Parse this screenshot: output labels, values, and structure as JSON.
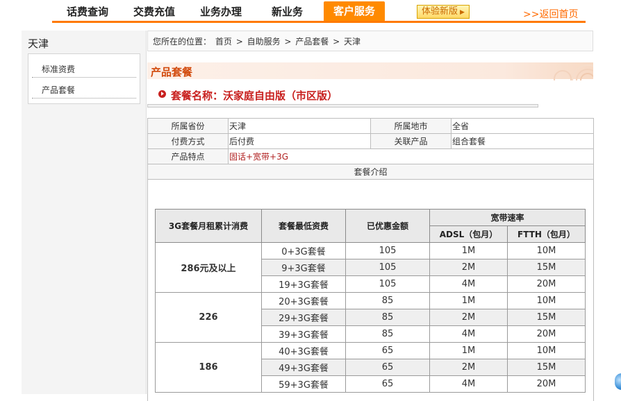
{
  "nav": {
    "items": [
      "话费查询",
      "交费充值",
      "业务办理",
      "新业务",
      "客户服务"
    ],
    "active_index": 4,
    "trial_label": "体验新版",
    "home_label": ">>返回首页"
  },
  "sidebar": {
    "title": "天津",
    "items": [
      "标准资费",
      "产品套餐"
    ]
  },
  "breadcrumb": {
    "prefix": "您所在的位置：",
    "parts": [
      "首页",
      "自助服务",
      "产品套餐",
      "天津"
    ],
    "separator": ">"
  },
  "section": {
    "title": "产品套餐",
    "package_name": "套餐名称：沃家庭自由版（市区版）"
  },
  "info": {
    "province_label": "所属省份",
    "province_value": "天津",
    "city_label": "所属地市",
    "city_value": "全省",
    "pay_label": "付费方式",
    "pay_value": "后付费",
    "related_label": "关联产品",
    "related_value": "组合套餐",
    "feature_label": "产品特点",
    "feature_value": "固话+宽带+3G",
    "intro_label": "套餐介绍"
  },
  "rates": {
    "headers": {
      "monthly": "3G套餐月租累计消费",
      "min_fee": "套餐最低资费",
      "discount": "已优惠金额",
      "speed": "宽带速率",
      "adsl": "ADSL（包月）",
      "ftth": "FTTH（包月）"
    },
    "groups": [
      {
        "monthly": "286元及以上",
        "rows": [
          {
            "plan": "0+3G套餐",
            "discount": "105",
            "adsl": "1M",
            "ftth": "10M"
          },
          {
            "plan": "9+3G套餐",
            "discount": "105",
            "adsl": "2M",
            "ftth": "15M"
          },
          {
            "plan": "19+3G套餐",
            "discount": "105",
            "adsl": "4M",
            "ftth": "20M"
          }
        ]
      },
      {
        "monthly": "226",
        "rows": [
          {
            "plan": "20+3G套餐",
            "discount": "85",
            "adsl": "1M",
            "ftth": "10M"
          },
          {
            "plan": "29+3G套餐",
            "discount": "85",
            "adsl": "2M",
            "ftth": "15M"
          },
          {
            "plan": "39+3G套餐",
            "discount": "85",
            "adsl": "4M",
            "ftth": "20M"
          }
        ]
      },
      {
        "monthly": "186",
        "rows": [
          {
            "plan": "40+3G套餐",
            "discount": "65",
            "adsl": "1M",
            "ftth": "10M"
          },
          {
            "plan": "49+3G套餐",
            "discount": "65",
            "adsl": "2M",
            "ftth": "15M"
          },
          {
            "plan": "59+3G套餐",
            "discount": "65",
            "adsl": "4M",
            "ftth": "20M"
          }
        ]
      }
    ]
  },
  "colors": {
    "accent": "#ff8a00",
    "title_red": "#c8201e",
    "section_orange": "#d24a0c"
  }
}
